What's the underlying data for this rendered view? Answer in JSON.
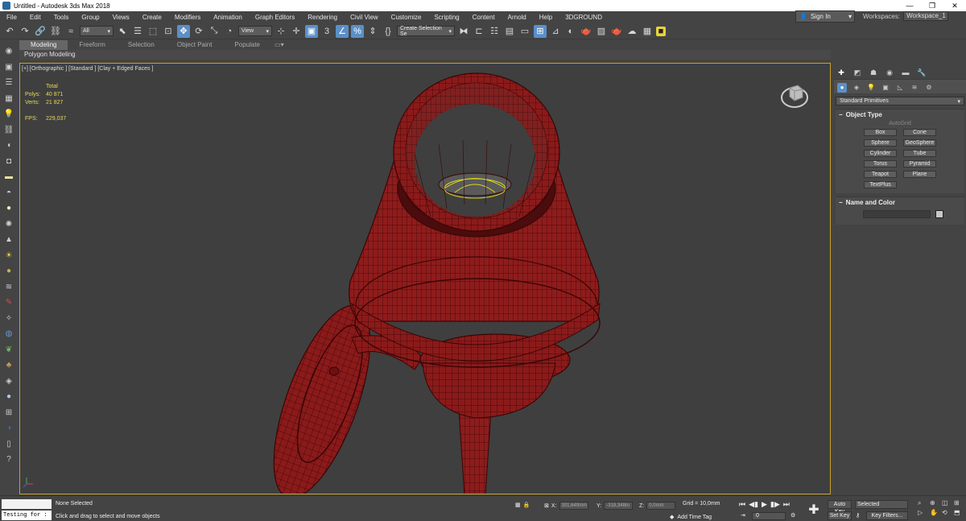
{
  "window": {
    "title": "Untitled - Autodesk 3ds Max 2018",
    "controls": [
      "—",
      "❐",
      "✕"
    ]
  },
  "menu": [
    "File",
    "Edit",
    "Tools",
    "Group",
    "Views",
    "Create",
    "Modifiers",
    "Animation",
    "Graph Editors",
    "Rendering",
    "Civil View",
    "Customize",
    "Scripting",
    "Content",
    "Arnold",
    "Help",
    "3DGROUND"
  ],
  "account": {
    "sign_in": "Sign In",
    "workspaces_label": "Workspaces:",
    "workspace": "Workspace_1"
  },
  "toolbar": {
    "filter": "All",
    "ref_coord": "View",
    "selection_set": "Create Selection Se"
  },
  "ribbon": {
    "tabs": [
      "Modeling",
      "Freeform",
      "Selection",
      "Object Paint",
      "Populate"
    ],
    "active_tab": "Modeling",
    "subpanel": "Polygon Modeling"
  },
  "viewport": {
    "label": "[+] [Orthographic ] [Standard ] [Clay + Edged Faces ]",
    "stats": {
      "header": "Total",
      "polys_label": "Polys:",
      "polys": "40 871",
      "verts_label": "Verts:",
      "verts": "21 827",
      "fps_label": "FPS:",
      "fps": "229,037"
    }
  },
  "command_panel": {
    "category": "Standard Primitives",
    "object_type_title": "Object Type",
    "autogrid": "AutoGrid",
    "objects": [
      "Box",
      "Cone",
      "Sphere",
      "GeoSphere",
      "Cylinder",
      "Tube",
      "Torus",
      "Pyramid",
      "Teapot",
      "Plane",
      "TextPlus"
    ],
    "name_color_title": "Name and Color"
  },
  "status": {
    "maxscript_input": "Testing for :",
    "selection": "None Selected",
    "hint": "Click and drag to select and move objects",
    "x_label": "X:",
    "x_value": "301,649mm",
    "y_label": "Y:",
    "y_value": "-318,348m",
    "z_label": "Z:",
    "z_value": "0,0mm",
    "grid": "Grid = 10,0mm",
    "add_time_tag": "Add Time Tag",
    "frame": "0",
    "auto_key": "Auto Key",
    "set_key": "Set Key",
    "selected": "Selected",
    "key_filters": "Key Filters..."
  },
  "colors": {
    "accent": "#5b8fc7",
    "viewport_border": "#c9a227",
    "model": "#8b1a1a",
    "wire": "#3a0505",
    "stats": "#e8d85a"
  }
}
